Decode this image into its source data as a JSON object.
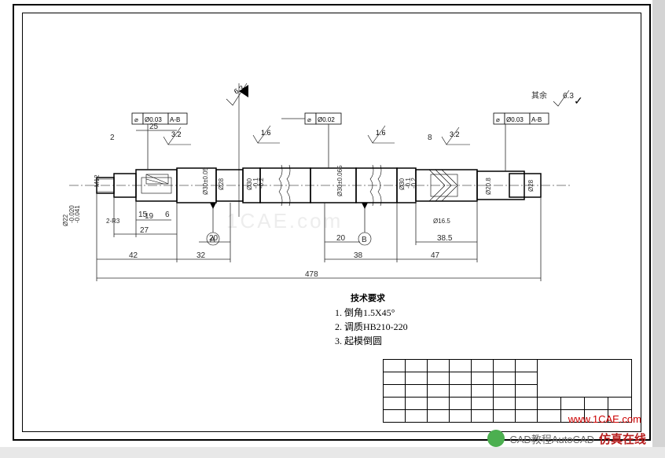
{
  "drawing": {
    "title_block_rows": 5,
    "title_block_cols": 10,
    "overall_length": "478",
    "tech_requirements_title": "技术要求",
    "tech_requirements": [
      "1. 倒角1.5X45°",
      "2. 调质HB210-220",
      "3. 起模倒圆"
    ],
    "general_roughness": "6.3",
    "general_roughness_prefix": "其余"
  },
  "tolerances": {
    "left_frame": {
      "symbol": "⌀",
      "value": "Ø0.03",
      "datum": "A-B"
    },
    "mid_frame": {
      "symbol": "⌀",
      "value": "Ø0.02",
      "datum": ""
    },
    "right_frame": {
      "symbol": "⌀",
      "value": "Ø0.03",
      "datum": "A-B"
    }
  },
  "datums": {
    "a": "A",
    "b": "B"
  },
  "surface_finish": {
    "left_step": "3.2",
    "mid_left": "1.6",
    "mid_right": "1.6",
    "top_section": "6.3",
    "right_step": "3.2"
  },
  "dimensions": {
    "lengths": {
      "l_2": "2",
      "l_25": "25",
      "l_19": "19",
      "l_15": "15",
      "l_6": "6",
      "l_27": "27",
      "l_42": "42",
      "l_32": "32",
      "l_20a": "20",
      "l_20b": "20",
      "l_38": "38",
      "l_47": "47",
      "l_38_5": "38.5",
      "l_8": "8",
      "l_478": "478"
    },
    "diameters": {
      "d_m12": "M12",
      "d22": "Ø22",
      "d22_tol_upper": "-0.020",
      "d22_tol_lower": "-0.041",
      "d30": "Ø30±0.05",
      "d28": "Ø28",
      "d30a": "Ø30",
      "d30a_tol_upper": "-0.1",
      "d30a_tol_lower": "-0.2",
      "d30b": "Ø30±0.065",
      "d30c": "Ø30",
      "d30c_tol_upper": "-0.1",
      "d30c_tol_lower": "-0.2",
      "d20_8": "Ø20.8",
      "d28r": "Ø28",
      "d16_5": "Ø16.5"
    },
    "radii": {
      "r3": "2-R3"
    }
  },
  "watermarks": {
    "center": "1CAE.com",
    "bottom": "www.1CAE.com",
    "logo_text_cad": "CAD教程AutoCAD",
    "logo_text_sim": "仿真在线"
  }
}
